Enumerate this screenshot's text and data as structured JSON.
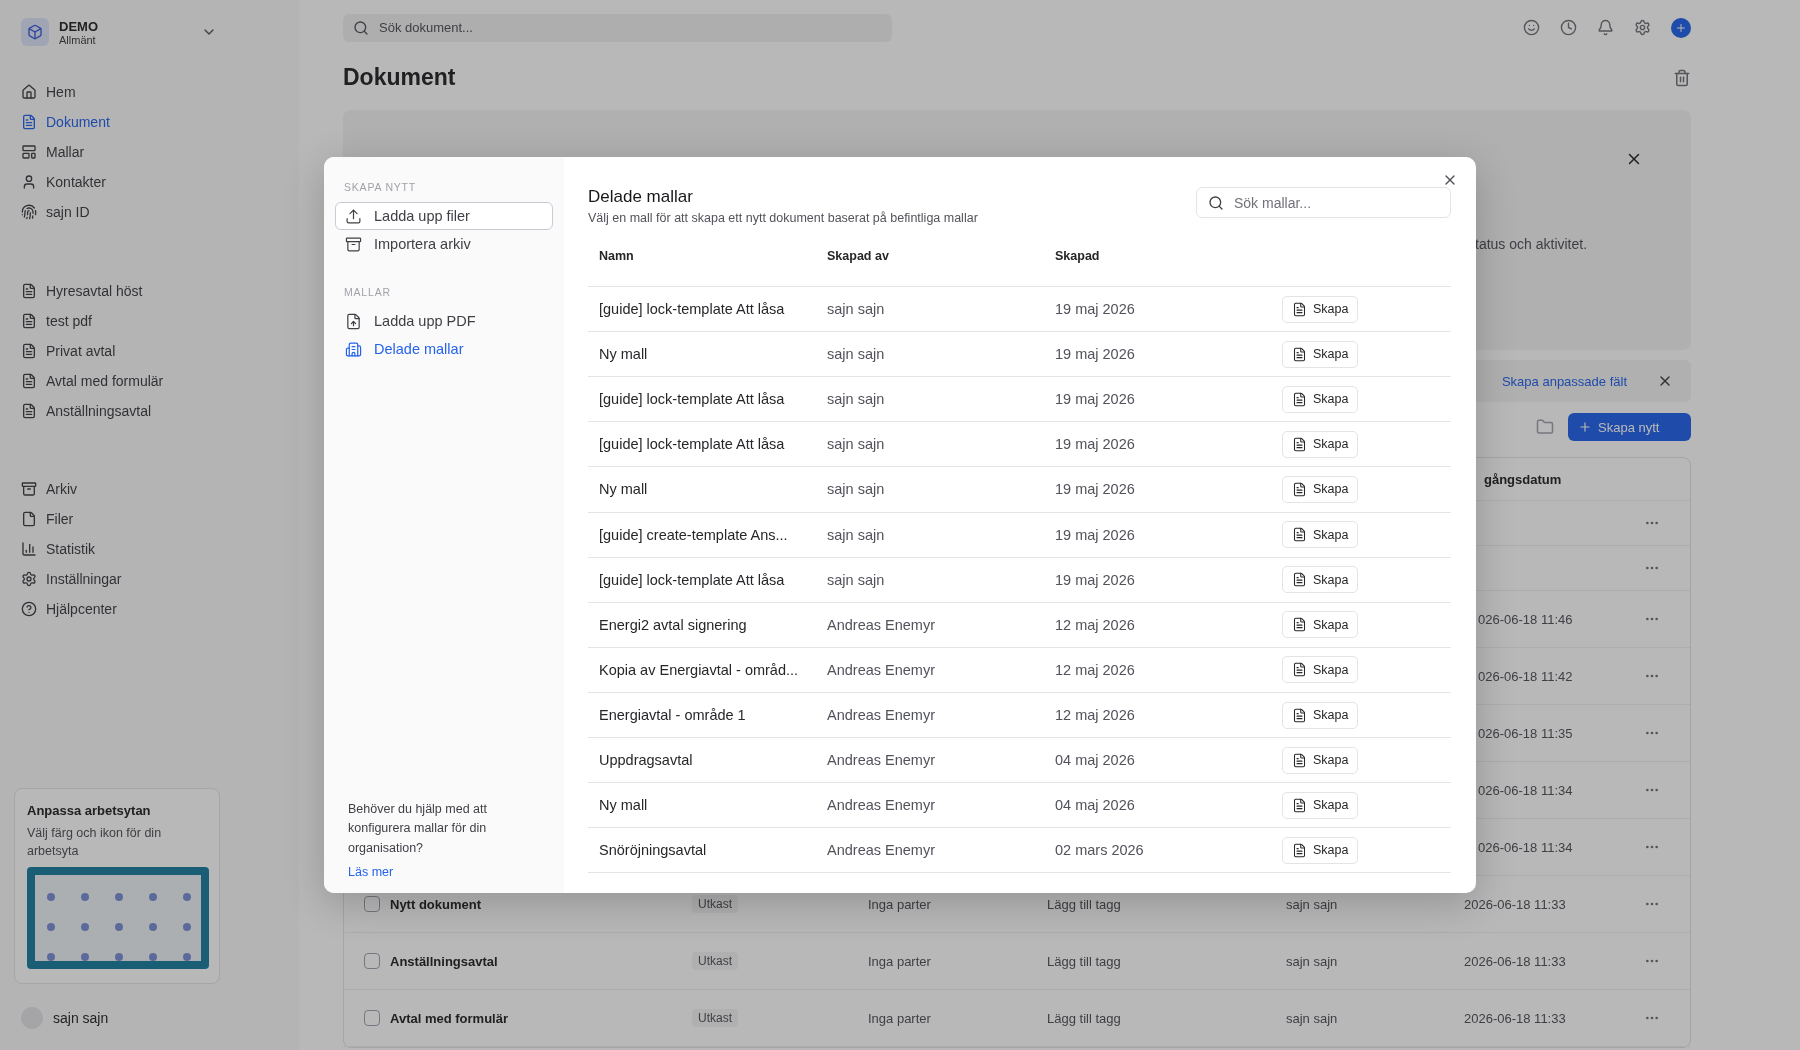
{
  "background": {
    "workspace": {
      "name": "DEMO",
      "subtitle": "Allmänt"
    },
    "nav": [
      {
        "label": "Hem",
        "selected": false
      },
      {
        "label": "Dokument",
        "selected": true
      },
      {
        "label": "Mallar",
        "selected": false
      },
      {
        "label": "Kontakter",
        "selected": false
      },
      {
        "label": "sajn ID",
        "selected": false
      }
    ],
    "recent": [
      "Hyresavtal höst",
      "test pdf",
      "Privat avtal",
      "Avtal med formulär",
      "Anställningsavtal"
    ],
    "more": [
      "Arkiv",
      "Filer",
      "Statistik",
      "Inställningar",
      "Hjälpcenter"
    ],
    "customize_card": {
      "title": "Anpassa arbetsytan",
      "text": "Välj färg och ikon för din arbetsyta"
    },
    "user": {
      "name": "sajn sajn"
    },
    "search": {
      "placeholder": "Sök dokument..."
    },
    "title": "Dokument",
    "tips": {
      "text": "tatus och aktivitet."
    },
    "custom_fields_link": "Skapa anpassade fält",
    "new_button": "Skapa nytt",
    "table": {
      "column_header": "gångsdatum",
      "rows": [
        {
          "kind": "empty"
        },
        {
          "kind": "empty"
        },
        {
          "kind": "partial",
          "date": "026-06-18 11:46"
        },
        {
          "kind": "partial",
          "date": "026-06-18 11:42"
        },
        {
          "kind": "partial",
          "date": "026-06-18 11:35"
        },
        {
          "kind": "partial",
          "date": "026-06-18 11:34"
        },
        {
          "kind": "partial",
          "date": "026-06-18 11:34"
        },
        {
          "kind": "full",
          "checked": false,
          "name": "Nytt dokument",
          "status": "Utkast",
          "parties": "Inga parter",
          "tags": "Lägg till tagg",
          "owner": "sajn sajn",
          "date": "2026-06-18 11:33"
        },
        {
          "kind": "full",
          "checked": false,
          "name": "Anställningsavtal",
          "status": "Utkast",
          "parties": "Inga parter",
          "tags": "Lägg till tagg",
          "owner": "sajn sajn",
          "date": "2026-06-18 11:33"
        },
        {
          "kind": "full",
          "checked": false,
          "name": "Avtal med formulär",
          "status": "Utkast",
          "parties": "Inga parter",
          "tags": "Lägg till tagg",
          "owner": "sajn sajn",
          "date": "2026-06-18 11:33"
        }
      ]
    }
  },
  "modal": {
    "sections": [
      {
        "heading": "SKAPA NYTT",
        "items": [
          {
            "label": "Ladda upp filer",
            "selected": false,
            "focused": true
          },
          {
            "label": "Importera arkiv",
            "selected": false,
            "focused": false
          }
        ]
      },
      {
        "heading": "MALLAR",
        "items": [
          {
            "label": "Ladda upp PDF",
            "selected": false,
            "focused": false
          },
          {
            "label": "Delade mallar",
            "selected": true,
            "focused": false
          }
        ]
      }
    ],
    "help": {
      "text": "Behöver du hjälp med att konfigurera mallar för din organisation?",
      "link": "Läs mer"
    },
    "title": "Delade mallar",
    "subtitle": "Välj en mall för att skapa ett nytt dokument baserat på befintliga mallar",
    "search": {
      "placeholder": "Sök mallar..."
    },
    "table": {
      "columns": [
        "Namn",
        "Skapad av",
        "Skapad"
      ],
      "rows": [
        {
          "name": "[guide] lock-template Att låsa",
          "author": "sajn sajn",
          "created": "19 maj 2026",
          "action": "Skapa"
        },
        {
          "name": "Ny mall",
          "author": "sajn sajn",
          "created": "19 maj 2026",
          "action": "Skapa"
        },
        {
          "name": "[guide] lock-template Att låsa",
          "author": "sajn sajn",
          "created": "19 maj 2026",
          "action": "Skapa"
        },
        {
          "name": "[guide] lock-template Att låsa",
          "author": "sajn sajn",
          "created": "19 maj 2026",
          "action": "Skapa"
        },
        {
          "name": "Ny mall",
          "author": "sajn sajn",
          "created": "19 maj 2026",
          "action": "Skapa"
        },
        {
          "name": "[guide] create-template Ans...",
          "author": "sajn sajn",
          "created": "19 maj 2026",
          "action": "Skapa"
        },
        {
          "name": "[guide] lock-template Att låsa",
          "author": "sajn sajn",
          "created": "19 maj 2026",
          "action": "Skapa"
        },
        {
          "name": "Energi2 avtal signering",
          "author": "Andreas Enemyr",
          "created": "12 maj 2026",
          "action": "Skapa"
        },
        {
          "name": "Kopia av Energiavtal - områd...",
          "author": "Andreas Enemyr",
          "created": "12 maj 2026",
          "action": "Skapa"
        },
        {
          "name": "Energiavtal - område 1",
          "author": "Andreas Enemyr",
          "created": "12 maj 2026",
          "action": "Skapa"
        },
        {
          "name": "Uppdragsavtal",
          "author": "Andreas Enemyr",
          "created": "04 maj 2026",
          "action": "Skapa"
        },
        {
          "name": "Ny mall",
          "author": "Andreas Enemyr",
          "created": "04 maj 2026",
          "action": "Skapa"
        },
        {
          "name": "Snöröjningsavtal",
          "author": "Andreas Enemyr",
          "created": "02 mars 2026",
          "action": "Skapa"
        }
      ]
    }
  }
}
